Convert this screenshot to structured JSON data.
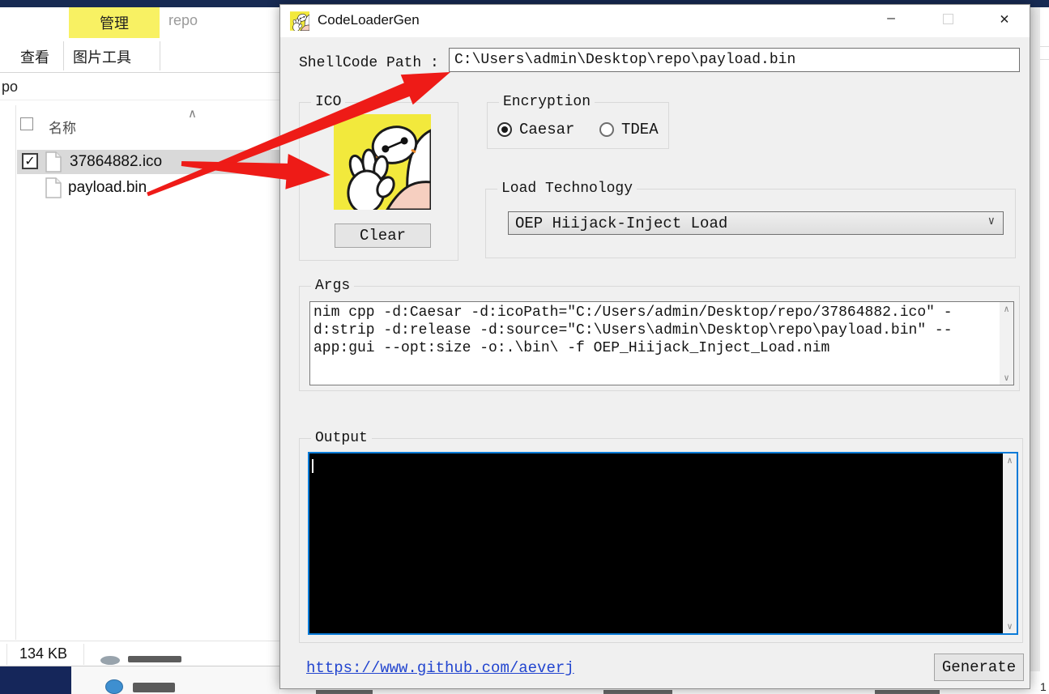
{
  "explorer": {
    "ribbon": {
      "manage_tab": "管理",
      "title": "repo",
      "view_tab": "查看",
      "picture_tools_tab": "图片工具"
    },
    "address_fragment": "po",
    "list": {
      "name_header": "名称",
      "sort_icon": "∧",
      "check_icon": "✓",
      "rows": [
        {
          "name": "37864882.ico"
        },
        {
          "name": "payload.bin"
        }
      ]
    },
    "status": {
      "size": "134 KB"
    },
    "bottom_fragment": "1"
  },
  "dialog": {
    "title": "CodeLoaderGen",
    "controls": {
      "minimize_icon": "—",
      "close_icon": "✕"
    },
    "shellcode": {
      "label": "ShellCode Path :",
      "value": "C:\\Users\\admin\\Desktop\\repo\\payload.bin"
    },
    "ico_group": {
      "label": "ICO",
      "clear_button": "Clear"
    },
    "encryption_group": {
      "label": "Encryption",
      "caesar_label": "Caesar",
      "tdea_label": "TDEA"
    },
    "load_group": {
      "label": "Load Technology",
      "selected": "OEP Hiijack-Inject Load",
      "chevron_icon": "∨"
    },
    "args_group": {
      "label": "Args",
      "value": "nim cpp -d:Caesar -d:icoPath=″C:/Users/admin/Desktop/repo/37864882.ico″ -d:strip -d:release -d:source=″C:\\Users\\admin\\Desktop\\repo\\payload.bin″ --app:gui --opt:size -o:.\\bin\\ -f OEP_Hiijack_Inject_Load.nim"
    },
    "output_group": {
      "label": "Output"
    },
    "footer": {
      "link": "https://www.github.com/aeverj",
      "generate_button": "Generate"
    }
  },
  "icons": {
    "chevron_up": "∧",
    "chevron_down": "∨"
  },
  "colors": {
    "accent_blue": "#0a7bd8",
    "arrow_red": "#ee1b17",
    "selection_gray": "#d9d9d9",
    "tab_yellow": "#f8f163",
    "navy": "#172a53"
  }
}
